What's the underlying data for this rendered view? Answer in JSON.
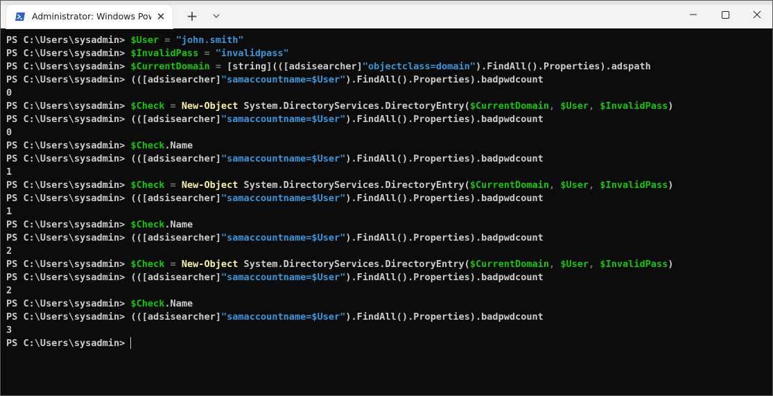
{
  "window": {
    "tab_title": "Administrator: Windows PowerShell",
    "new_tab_label": "+",
    "close_tab_label": "✕"
  },
  "colors": {
    "background": "#0c0c0c",
    "text": "#cccccc",
    "variable": "#16c60c",
    "string": "#3a96dd",
    "operator": "#767676",
    "command": "#f9f1a5"
  },
  "terminal": {
    "lines": [
      [
        [
          "PS C:\\Users\\sysadmin> ",
          "default"
        ],
        [
          "$User",
          "var"
        ],
        [
          " = ",
          "op"
        ],
        [
          "\"john.smith\"",
          "str"
        ]
      ],
      [
        [
          "PS C:\\Users\\sysadmin> ",
          "default"
        ],
        [
          "$InvalidPass",
          "var"
        ],
        [
          " = ",
          "op"
        ],
        [
          "\"invalidpass\"",
          "str"
        ]
      ],
      [
        [
          "PS C:\\Users\\sysadmin> ",
          "default"
        ],
        [
          "$CurrentDomain",
          "var"
        ],
        [
          " = ",
          "op"
        ],
        [
          "[string](([adsisearcher]",
          "default"
        ],
        [
          "\"objectclass=domain\"",
          "str"
        ],
        [
          ").FindAll().Properties).adspath",
          "default"
        ]
      ],
      [
        [
          "PS C:\\Users\\sysadmin> ",
          "default"
        ],
        [
          "(([adsisearcher]",
          "default"
        ],
        [
          "\"samaccountname=$User\"",
          "str"
        ],
        [
          ").FindAll().Properties).badpwdcount",
          "default"
        ]
      ],
      [
        [
          "0",
          "default"
        ]
      ],
      [
        [
          "PS C:\\Users\\sysadmin> ",
          "default"
        ],
        [
          "$Check",
          "var"
        ],
        [
          " = ",
          "op"
        ],
        [
          "New-Object",
          "cmd"
        ],
        [
          " System.DirectoryServices.DirectoryEntry(",
          "default"
        ],
        [
          "$CurrentDomain",
          "var"
        ],
        [
          ", ",
          "op"
        ],
        [
          "$User",
          "var"
        ],
        [
          ", ",
          "op"
        ],
        [
          "$InvalidPass",
          "var"
        ],
        [
          ")",
          "default"
        ]
      ],
      [
        [
          "PS C:\\Users\\sysadmin> ",
          "default"
        ],
        [
          "(([adsisearcher]",
          "default"
        ],
        [
          "\"samaccountname=$User\"",
          "str"
        ],
        [
          ").FindAll().Properties).badpwdcount",
          "default"
        ]
      ],
      [
        [
          "0",
          "default"
        ]
      ],
      [
        [
          "PS C:\\Users\\sysadmin> ",
          "default"
        ],
        [
          "$Check",
          "var"
        ],
        [
          ".Name",
          "default"
        ]
      ],
      [
        [
          "PS C:\\Users\\sysadmin> ",
          "default"
        ],
        [
          "(([adsisearcher]",
          "default"
        ],
        [
          "\"samaccountname=$User\"",
          "str"
        ],
        [
          ").FindAll().Properties).badpwdcount",
          "default"
        ]
      ],
      [
        [
          "1",
          "default"
        ]
      ],
      [
        [
          "PS C:\\Users\\sysadmin> ",
          "default"
        ],
        [
          "$Check",
          "var"
        ],
        [
          " = ",
          "op"
        ],
        [
          "New-Object",
          "cmd"
        ],
        [
          " System.DirectoryServices.DirectoryEntry(",
          "default"
        ],
        [
          "$CurrentDomain",
          "var"
        ],
        [
          ", ",
          "op"
        ],
        [
          "$User",
          "var"
        ],
        [
          ", ",
          "op"
        ],
        [
          "$InvalidPass",
          "var"
        ],
        [
          ")",
          "default"
        ]
      ],
      [
        [
          "PS C:\\Users\\sysadmin> ",
          "default"
        ],
        [
          "(([adsisearcher]",
          "default"
        ],
        [
          "\"samaccountname=$User\"",
          "str"
        ],
        [
          ").FindAll().Properties).badpwdcount",
          "default"
        ]
      ],
      [
        [
          "1",
          "default"
        ]
      ],
      [
        [
          "PS C:\\Users\\sysadmin> ",
          "default"
        ],
        [
          "$Check",
          "var"
        ],
        [
          ".Name",
          "default"
        ]
      ],
      [
        [
          "PS C:\\Users\\sysadmin> ",
          "default"
        ],
        [
          "(([adsisearcher]",
          "default"
        ],
        [
          "\"samaccountname=$User\"",
          "str"
        ],
        [
          ").FindAll().Properties).badpwdcount",
          "default"
        ]
      ],
      [
        [
          "2",
          "default"
        ]
      ],
      [
        [
          "PS C:\\Users\\sysadmin> ",
          "default"
        ],
        [
          "$Check",
          "var"
        ],
        [
          " = ",
          "op"
        ],
        [
          "New-Object",
          "cmd"
        ],
        [
          " System.DirectoryServices.DirectoryEntry(",
          "default"
        ],
        [
          "$CurrentDomain",
          "var"
        ],
        [
          ", ",
          "op"
        ],
        [
          "$User",
          "var"
        ],
        [
          ", ",
          "op"
        ],
        [
          "$InvalidPass",
          "var"
        ],
        [
          ")",
          "default"
        ]
      ],
      [
        [
          "PS C:\\Users\\sysadmin> ",
          "default"
        ],
        [
          "(([adsisearcher]",
          "default"
        ],
        [
          "\"samaccountname=$User\"",
          "str"
        ],
        [
          ").FindAll().Properties).badpwdcount",
          "default"
        ]
      ],
      [
        [
          "2",
          "default"
        ]
      ],
      [
        [
          "PS C:\\Users\\sysadmin> ",
          "default"
        ],
        [
          "$Check",
          "var"
        ],
        [
          ".Name",
          "default"
        ]
      ],
      [
        [
          "PS C:\\Users\\sysadmin> ",
          "default"
        ],
        [
          "(([adsisearcher]",
          "default"
        ],
        [
          "\"samaccountname=$User\"",
          "str"
        ],
        [
          ").FindAll().Properties).badpwdcount",
          "default"
        ]
      ],
      [
        [
          "3",
          "default"
        ]
      ]
    ],
    "prompt": "PS C:\\Users\\sysadmin> "
  }
}
